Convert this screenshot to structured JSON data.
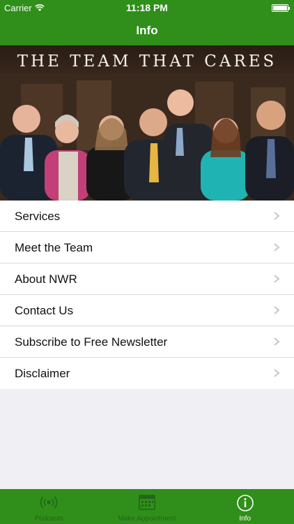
{
  "status": {
    "carrier": "Carrier",
    "time": "11:18 PM"
  },
  "nav": {
    "title": "Info"
  },
  "banner": {
    "title": "THE TEAM THAT CARES"
  },
  "menu": {
    "items": [
      {
        "label": "Services"
      },
      {
        "label": "Meet the Team"
      },
      {
        "label": "About NWR"
      },
      {
        "label": "Contact Us"
      },
      {
        "label": "Subscribe to Free Newsletter"
      },
      {
        "label": "Disclaimer"
      }
    ]
  },
  "tabs": [
    {
      "label": "Podcasts",
      "icon": "podcast-icon",
      "active": false
    },
    {
      "label": "Make Appointment",
      "icon": "calendar-icon",
      "active": false
    },
    {
      "label": "Info",
      "icon": "info-icon",
      "active": true
    }
  ],
  "colors": {
    "brand_green": "#2f8f1a",
    "inactive_tab": "#23661a",
    "background": "#efeff4"
  }
}
